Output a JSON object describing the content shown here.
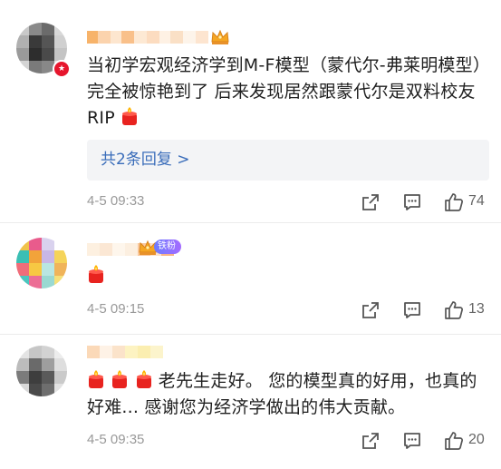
{
  "comments": [
    {
      "text": "当初学宏观经济学到M-F模型（蒙代尔-弗莱明模型）完全被惊艳到了 后来发现居然跟蒙代尔是双料校友 RIP",
      "reply_link": "共2条回复 >",
      "time": "4-5 09:33",
      "likes": "74"
    },
    {
      "text": "",
      "badge": "铁粉",
      "time": "4-5 09:15",
      "likes": "13"
    },
    {
      "text": "老先生走好。 您的模型真的好用，也真的好难... 感谢您为经济学做出的伟大贡献。",
      "time": "4-5 09:35",
      "likes": "20"
    }
  ],
  "icons": [
    "share-icon",
    "comment-icon",
    "like-icon",
    "candle-emoji-icon",
    "crown-icon",
    "verified-icon"
  ],
  "colors": {
    "link": "#3a6dba",
    "time": "#999999",
    "verified": "#e6162d",
    "candle": "#e8231f"
  }
}
